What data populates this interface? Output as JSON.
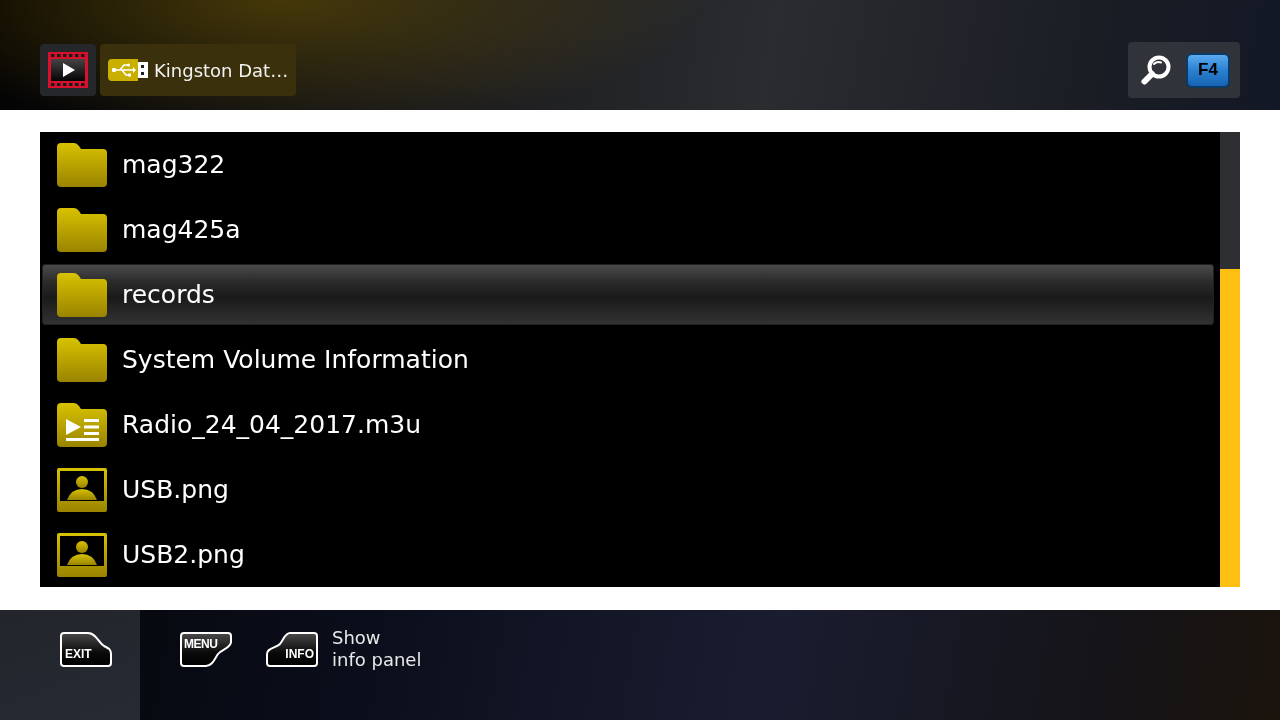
{
  "header": {
    "breadcrumb": [
      {
        "kind": "video",
        "selected": false
      },
      {
        "kind": "usb",
        "label": "Kingston Dat…",
        "selected": true
      }
    ],
    "search_key": "F4"
  },
  "files": [
    {
      "kind": "folder",
      "name": "mag322",
      "selected": false
    },
    {
      "kind": "folder",
      "name": "mag425a",
      "selected": false
    },
    {
      "kind": "folder",
      "name": "records",
      "selected": true
    },
    {
      "kind": "folder",
      "name": "System Volume Information",
      "selected": false
    },
    {
      "kind": "playlist",
      "name": "Radio_24_04_2017.m3u",
      "selected": false
    },
    {
      "kind": "image",
      "name": "USB.png",
      "selected": false
    },
    {
      "kind": "image",
      "name": "USB2.png",
      "selected": false
    }
  ],
  "footer": {
    "keys": [
      {
        "kind": "exit",
        "key": "EXIT",
        "selected": true
      },
      {
        "kind": "menu",
        "key": "MENU",
        "selected": false
      },
      {
        "kind": "info",
        "key": "INFO",
        "label": "Show\ninfo panel",
        "selected": false
      }
    ]
  }
}
